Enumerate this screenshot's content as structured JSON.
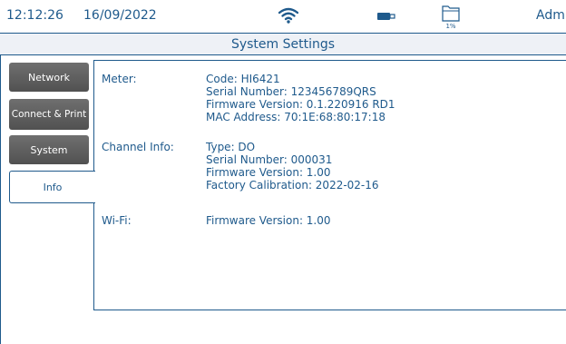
{
  "status_bar": {
    "time": "12:12:26",
    "date": "16/09/2022",
    "user": "Admin",
    "storage_percent": "1%",
    "icons": [
      "wifi-icon",
      "usb-icon",
      "folder-icon"
    ]
  },
  "title": "System Settings",
  "tabs": [
    {
      "label": "Network",
      "active": false
    },
    {
      "label": "Connect & Print",
      "active": false
    },
    {
      "label": "System",
      "active": false
    },
    {
      "label": "Info",
      "active": true
    }
  ],
  "info": {
    "meter": {
      "label": "Meter:",
      "code": "Code: HI6421",
      "serial": "Serial Number: 123456789QRS",
      "firmware": "Firmware Version: 0.1.220916 RD1",
      "mac": "MAC Address: 70:1E:68:80:17:18"
    },
    "channel": {
      "label": "Channel Info:",
      "type": "Type: DO",
      "serial": "Serial Number: 000031",
      "firmware": "Firmware Version: 1.00",
      "calibration": "Factory Calibration: 2022-02-16"
    },
    "wifi": {
      "label": "Wi-Fi:",
      "firmware": "Firmware Version: 1.00"
    }
  },
  "colors": {
    "accent": "#1f5a8c",
    "tab_inactive": "#5e5e5e",
    "title_bg": "#eef1f6"
  }
}
